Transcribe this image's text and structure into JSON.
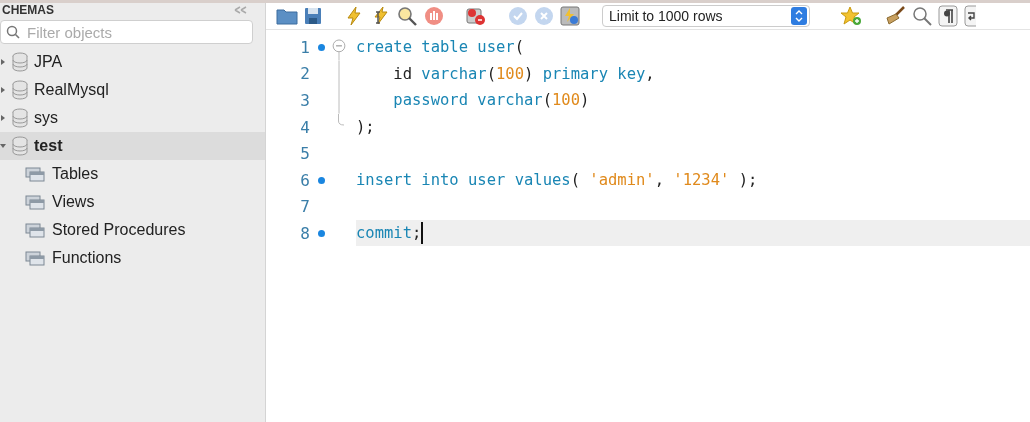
{
  "sidebar": {
    "header": "CHEMAS",
    "filter": {
      "placeholder": "Filter objects"
    },
    "schemas": [
      {
        "name": "JPA",
        "expanded": false,
        "selected": false
      },
      {
        "name": "RealMysql",
        "expanded": false,
        "selected": false
      },
      {
        "name": "sys",
        "expanded": false,
        "selected": false
      },
      {
        "name": "test",
        "expanded": true,
        "selected": true,
        "children": [
          {
            "name": "Tables"
          },
          {
            "name": "Views"
          },
          {
            "name": "Stored Procedures"
          },
          {
            "name": "Functions"
          }
        ]
      }
    ]
  },
  "toolbar": {
    "limit_select": "Limit to 1000 rows"
  },
  "editor": {
    "lines": [
      {
        "number": "1",
        "statement": true,
        "kind": "fold-start",
        "indented": false,
        "current": false,
        "tokens": [
          {
            "text": "create table user",
            "color": "#1a86b4"
          },
          {
            "text": "(",
            "color": "#222222"
          }
        ]
      },
      {
        "number": "2",
        "statement": false,
        "kind": "fold-body",
        "indented": true,
        "current": false,
        "tokens": [
          {
            "text": "id",
            "color": "#222222"
          },
          {
            "text": "varchar",
            "color": "#1a86b4",
            "space": true
          },
          {
            "text": "(",
            "color": "#222222"
          },
          {
            "text": "100",
            "color": "#e08a1c"
          },
          {
            "text": ")",
            "color": "#222222"
          },
          {
            "text": "primary key",
            "color": "#1a86b4",
            "space": true
          },
          {
            "text": ",",
            "color": "#222222"
          }
        ]
      },
      {
        "number": "3",
        "statement": false,
        "kind": "fold-body",
        "indented": true,
        "current": false,
        "tokens": [
          {
            "text": "password varchar",
            "color": "#1a86b4"
          },
          {
            "text": "(",
            "color": "#222222"
          },
          {
            "text": "100",
            "color": "#e08a1c"
          },
          {
            "text": ")",
            "color": "#222222"
          }
        ]
      },
      {
        "number": "4",
        "statement": false,
        "kind": "fold-end",
        "indented": false,
        "current": false,
        "tokens": [
          {
            "text": ");",
            "color": "#222222"
          }
        ]
      },
      {
        "number": "5",
        "statement": false,
        "kind": "plain",
        "current": false
      },
      {
        "number": "6",
        "statement": true,
        "kind": "plain",
        "indented": false,
        "current": false,
        "tokens": [
          {
            "text": "insert into user values",
            "color": "#1a86b4"
          },
          {
            "text": "(",
            "color": "#222222"
          },
          {
            "text": "'admin'",
            "color": "#e08a1c",
            "space": true
          },
          {
            "text": ",",
            "color": "#222222"
          },
          {
            "text": "'1234'",
            "color": "#e08a1c",
            "space": true
          },
          {
            "text": ");",
            "color": "#222222",
            "space": true
          }
        ]
      },
      {
        "number": "7",
        "statement": false,
        "kind": "plain",
        "current": false
      },
      {
        "number": "8",
        "statement": true,
        "kind": "plain",
        "indented": false,
        "current": true,
        "tokens": [
          {
            "text": "commit",
            "color": "#1a86b4"
          },
          {
            "text": ";",
            "color": "#222222"
          }
        ]
      }
    ]
  }
}
